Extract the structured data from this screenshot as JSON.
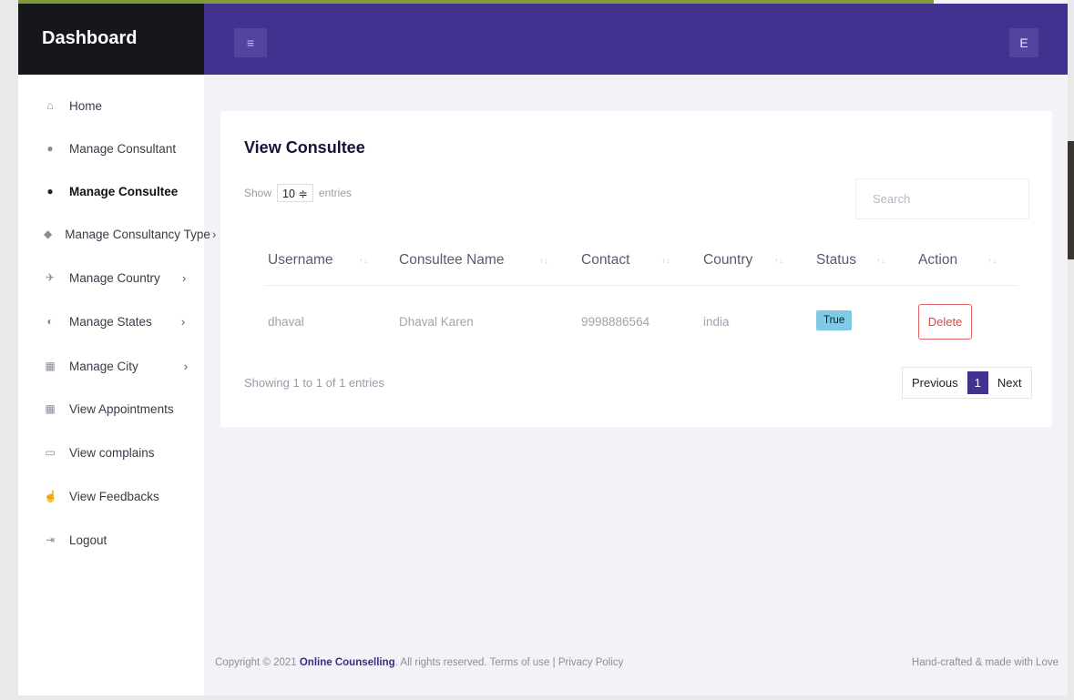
{
  "brand": {
    "title": "Dashboard"
  },
  "topbar": {
    "menu_glyph": "≡",
    "avatar_initial": "E"
  },
  "sidebar": {
    "items": [
      {
        "label": "Home",
        "icon": "home-icon",
        "glyph": "⌂",
        "chevron": ""
      },
      {
        "label": "Manage Consultant",
        "icon": "user-icon",
        "glyph": "●",
        "chevron": ""
      },
      {
        "label": "Manage Consultee",
        "icon": "user-icon",
        "glyph": "●",
        "chevron": "",
        "active": true
      },
      {
        "label": "Manage Consultancy Type",
        "icon": "layers-icon",
        "glyph": "◆",
        "chevron": "›"
      },
      {
        "label": "Manage Country",
        "icon": "plane-icon",
        "glyph": "✈",
        "chevron": "›"
      },
      {
        "label": "Manage States",
        "icon": "map-icon",
        "glyph": "◐",
        "chevron": "›"
      },
      {
        "label": "Manage City",
        "icon": "grid-icon",
        "glyph": "▦",
        "chevron": "›"
      },
      {
        "label": "View Appointments",
        "icon": "calendar-icon",
        "glyph": "▦",
        "chevron": ""
      },
      {
        "label": "View complains",
        "icon": "comment-icon",
        "glyph": "▭",
        "chevron": ""
      },
      {
        "label": "View Feedbacks",
        "icon": "thumbs-up-icon",
        "glyph": "☝",
        "chevron": ""
      },
      {
        "label": "Logout",
        "icon": "logout-icon",
        "glyph": "⇥",
        "chevron": ""
      }
    ]
  },
  "main": {
    "title": "View Consultee",
    "show_label": "Show",
    "entries_value": "10 ≑",
    "entries_label": "entries",
    "search_placeholder": "Search",
    "columns": [
      "Username",
      "Consultee Name",
      "Contact",
      "Country",
      "Status",
      "Action"
    ],
    "rows": [
      {
        "username": "dhaval",
        "name": "Dhaval Karen",
        "contact": "9998886564",
        "country": "india",
        "status": "True",
        "action": "Delete"
      }
    ],
    "info": "Showing 1 to 1 of 1 entries",
    "pager": {
      "previous": "Previous",
      "current": "1",
      "next": "Next"
    }
  },
  "footer": {
    "prefix": "Copyright © 2021 ",
    "brand": "Online Counselling",
    "suffix": ". All rights reserved. Terms of use | Privacy Policy",
    "right": "Hand-crafted & made with Love"
  },
  "colors": {
    "topbar": "#43318f",
    "brand_bg": "#16161d",
    "status_badge": "#7fcbe6",
    "delete": "#d94a4a"
  }
}
